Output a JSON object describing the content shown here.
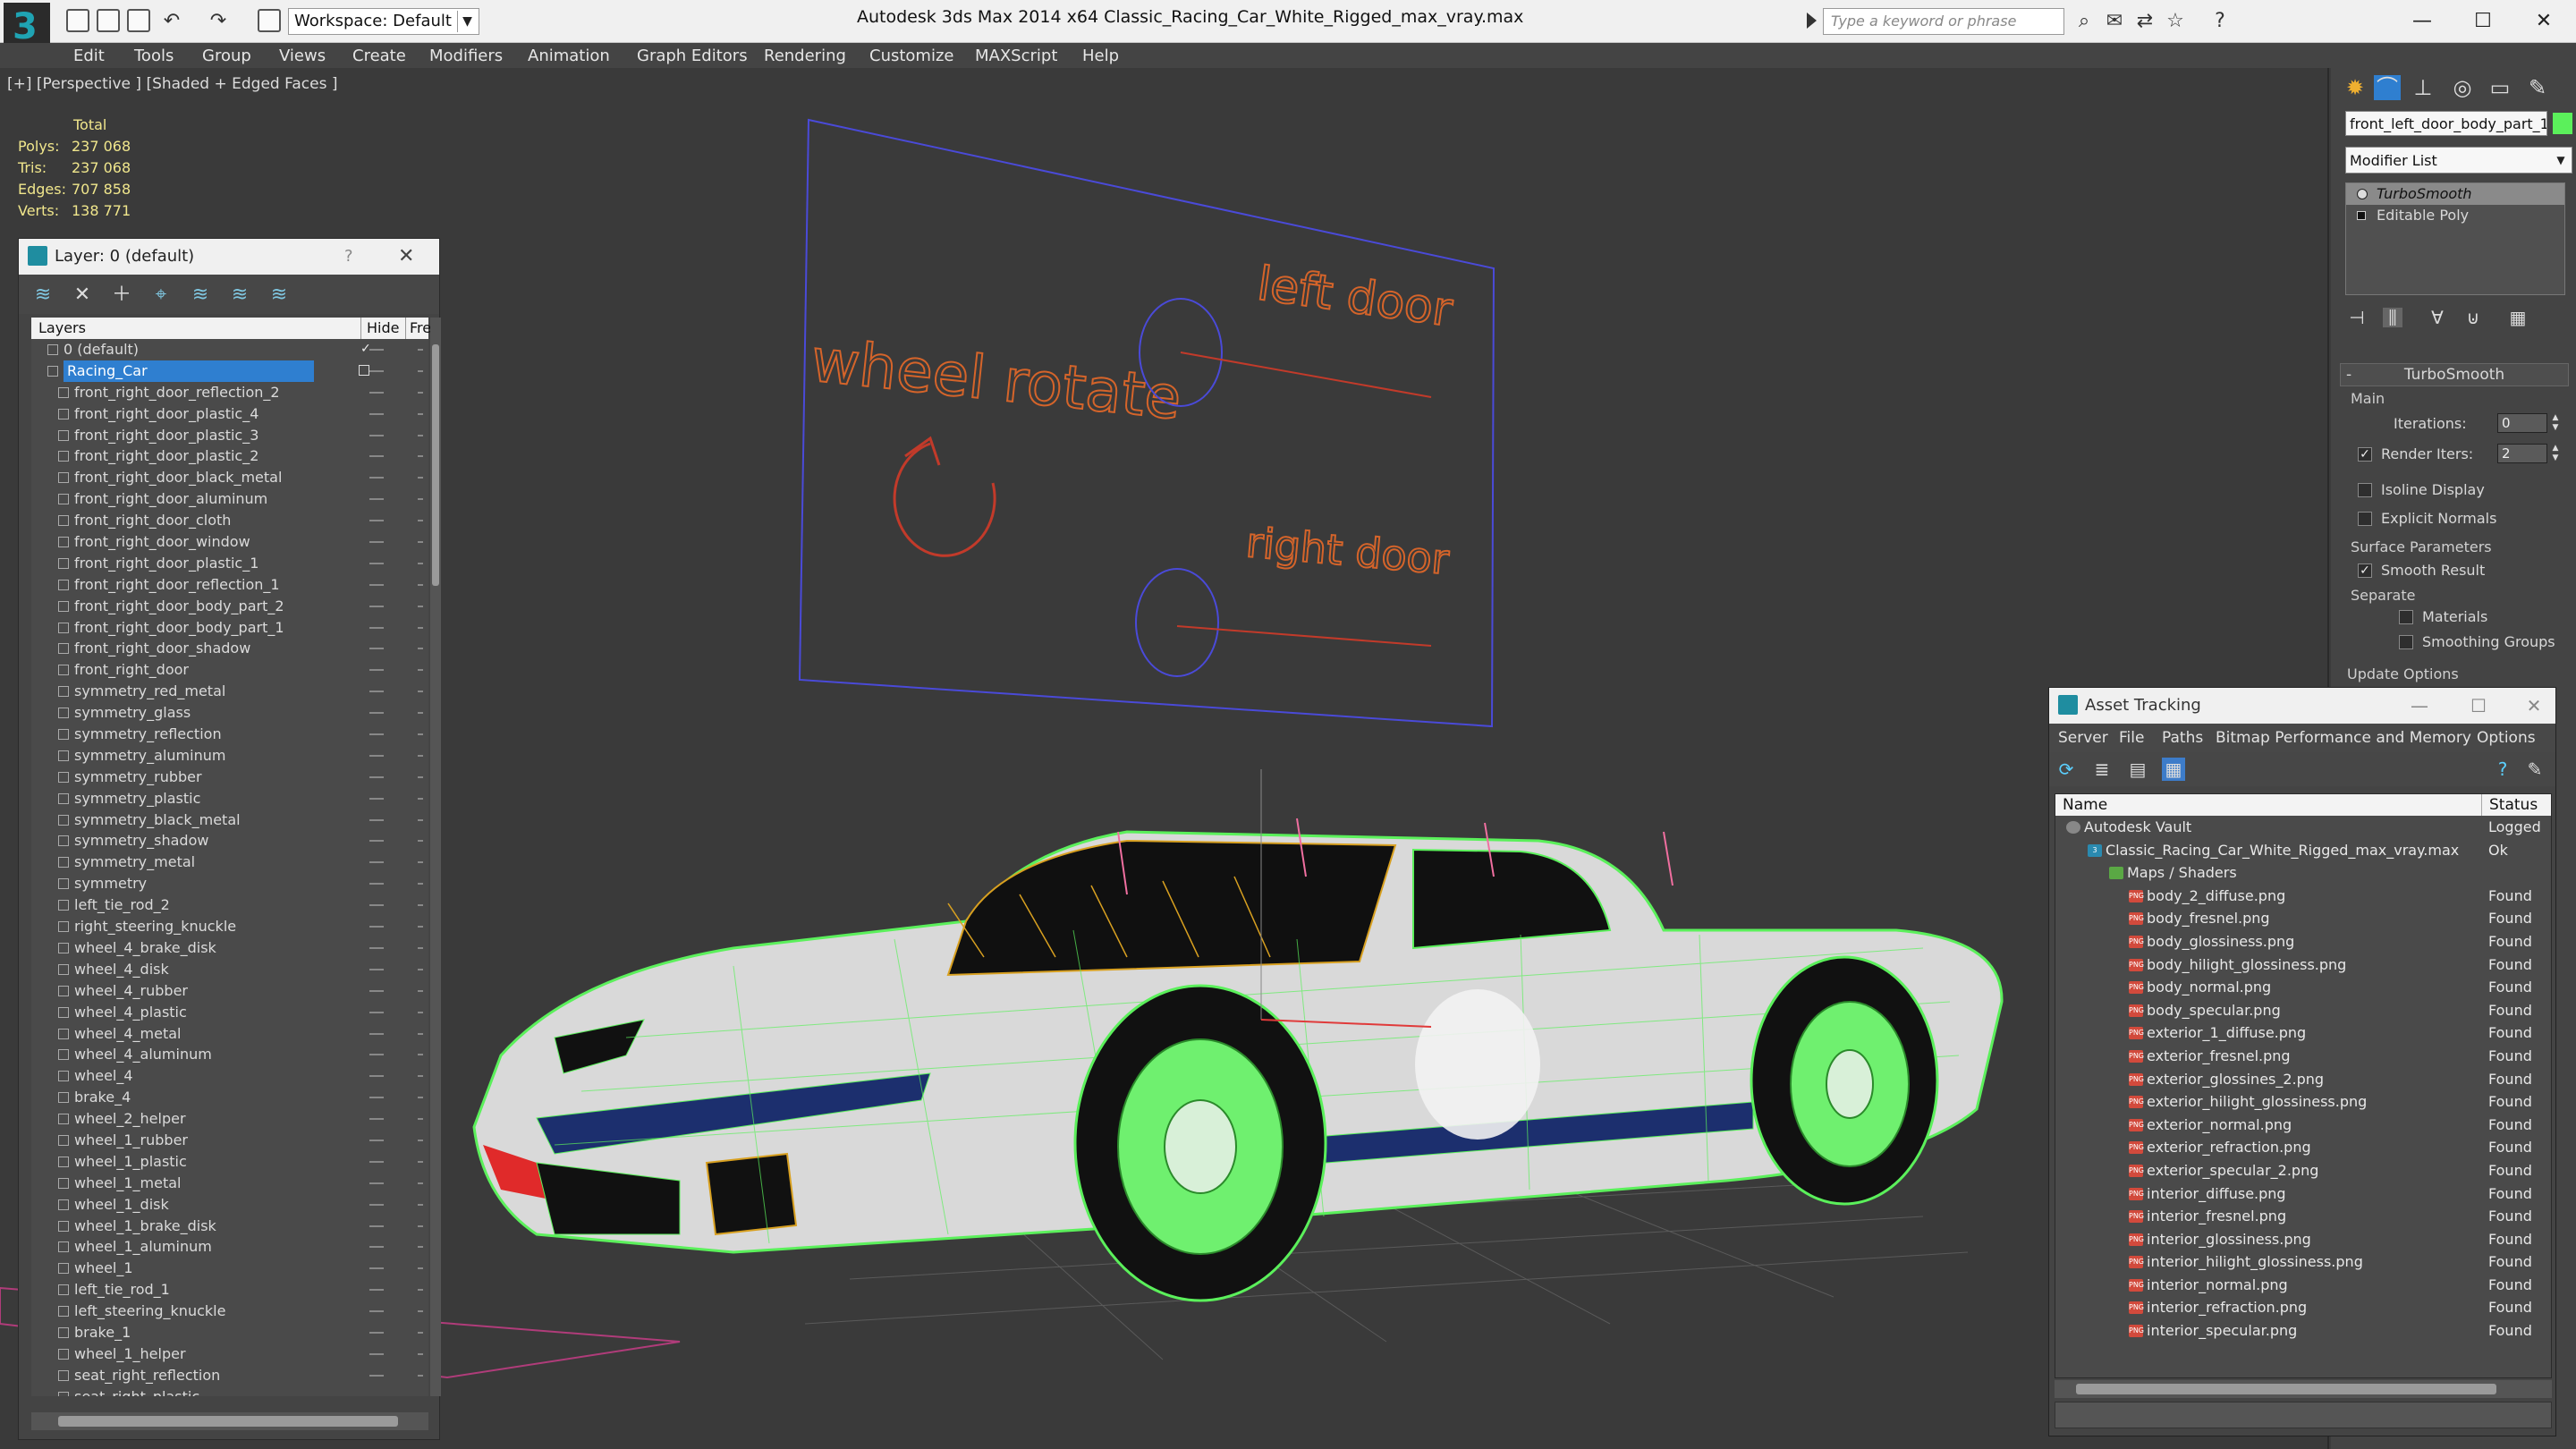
{
  "app": {
    "title": "Autodesk 3ds Max  2014 x64       Classic_Racing_Car_White_Rigged_max_vray.max",
    "workspace": "Workspace: Default",
    "search_placeholder": "Type a keyword or phrase"
  },
  "menu": [
    "Edit",
    "Tools",
    "Group",
    "Views",
    "Create",
    "Modifiers",
    "Animation",
    "Graph Editors",
    "Rendering",
    "Customize",
    "MAXScript",
    "Help"
  ],
  "viewport": {
    "label": "[+] [Perspective ] [Shaded + Edged Faces ]",
    "stats": {
      "header": "Total",
      "rows": [
        {
          "k": "Polys:",
          "v": "237 068"
        },
        {
          "k": "Tris:",
          "v": "237 068"
        },
        {
          "k": "Edges:",
          "v": "707 858"
        },
        {
          "k": "Verts:",
          "v": "138 771"
        }
      ]
    },
    "rig_panel": {
      "wheel_label": "wheel rotate",
      "left_door_label": "left door",
      "right_door_label": "right door"
    }
  },
  "layer_panel": {
    "title": "Layer: 0 (default)",
    "help": "?",
    "col_layers": "Layers",
    "col_hide": "Hide",
    "col_freeze": "Fre",
    "layers": [
      {
        "name": "0 (default)",
        "level": 0,
        "type": "layer",
        "checked": true
      },
      {
        "name": "Racing_Car",
        "level": 0,
        "type": "layer",
        "selected": true
      },
      {
        "name": "front_right_door_reflection_2",
        "level": 1
      },
      {
        "name": "front_right_door_plastic_4",
        "level": 1
      },
      {
        "name": "front_right_door_plastic_3",
        "level": 1
      },
      {
        "name": "front_right_door_plastic_2",
        "level": 1
      },
      {
        "name": "front_right_door_black_metal",
        "level": 1
      },
      {
        "name": "front_right_door_aluminum",
        "level": 1
      },
      {
        "name": "front_right_door_cloth",
        "level": 1
      },
      {
        "name": "front_right_door_window",
        "level": 1
      },
      {
        "name": "front_right_door_plastic_1",
        "level": 1
      },
      {
        "name": "front_right_door_reflection_1",
        "level": 1
      },
      {
        "name": "front_right_door_body_part_2",
        "level": 1
      },
      {
        "name": "front_right_door_body_part_1",
        "level": 1
      },
      {
        "name": "front_right_door_shadow",
        "level": 1
      },
      {
        "name": "front_right_door",
        "level": 1
      },
      {
        "name": "symmetry_red_metal",
        "level": 1
      },
      {
        "name": "symmetry_glass",
        "level": 1
      },
      {
        "name": "symmetry_reflection",
        "level": 1
      },
      {
        "name": "symmetry_aluminum",
        "level": 1
      },
      {
        "name": "symmetry_rubber",
        "level": 1
      },
      {
        "name": "symmetry_plastic",
        "level": 1
      },
      {
        "name": "symmetry_black_metal",
        "level": 1
      },
      {
        "name": "symmetry_shadow",
        "level": 1
      },
      {
        "name": "symmetry_metal",
        "level": 1
      },
      {
        "name": "symmetry",
        "level": 1
      },
      {
        "name": "left_tie_rod_2",
        "level": 1
      },
      {
        "name": "right_steering_knuckle",
        "level": 1
      },
      {
        "name": "wheel_4_brake_disk",
        "level": 1
      },
      {
        "name": "wheel_4_disk",
        "level": 1
      },
      {
        "name": "wheel_4_rubber",
        "level": 1
      },
      {
        "name": "wheel_4_plastic",
        "level": 1
      },
      {
        "name": "wheel_4_metal",
        "level": 1
      },
      {
        "name": "wheel_4_aluminum",
        "level": 1
      },
      {
        "name": "wheel_4",
        "level": 1
      },
      {
        "name": "brake_4",
        "level": 1
      },
      {
        "name": "wheel_2_helper",
        "level": 1
      },
      {
        "name": "wheel_1_rubber",
        "level": 1
      },
      {
        "name": "wheel_1_plastic",
        "level": 1
      },
      {
        "name": "wheel_1_metal",
        "level": 1
      },
      {
        "name": "wheel_1_disk",
        "level": 1
      },
      {
        "name": "wheel_1_brake_disk",
        "level": 1
      },
      {
        "name": "wheel_1_aluminum",
        "level": 1
      },
      {
        "name": "wheel_1",
        "level": 1
      },
      {
        "name": "left_tie_rod_1",
        "level": 1
      },
      {
        "name": "left_steering_knuckle",
        "level": 1
      },
      {
        "name": "brake_1",
        "level": 1
      },
      {
        "name": "wheel_1_helper",
        "level": 1
      },
      {
        "name": "seat_right_reflection",
        "level": 1
      },
      {
        "name": "seat_right_plastic",
        "level": 1
      }
    ]
  },
  "command_panel": {
    "object_name": "front_left_door_body_part_1",
    "modifier_list": "Modifier List",
    "stack": [
      {
        "name": "TurboSmooth",
        "selected": true
      },
      {
        "name": "Editable Poly",
        "selected": false
      }
    ],
    "rollout_title": "TurboSmooth",
    "main_group": "Main",
    "iterations_label": "Iterations:",
    "iterations_value": "0",
    "render_iters_label": "Render Iters:",
    "render_iters_value": "2",
    "isoline_label": "Isoline Display",
    "explicit_normals_label": "Explicit Normals",
    "surface_group": "Surface Parameters",
    "smooth_result_label": "Smooth Result",
    "separate_label": "Separate",
    "materials_label": "Materials",
    "smoothing_groups_label": "Smoothing Groups",
    "update_options": "Update Options"
  },
  "asset_tracking": {
    "title": "Asset Tracking",
    "menu": [
      "Server",
      "File",
      "Paths",
      "Bitmap Performance and Memory",
      "Options"
    ],
    "col_name": "Name",
    "col_status": "Status",
    "rows": [
      {
        "name": "Autodesk Vault",
        "status": "Logged",
        "level": 0,
        "icon": "vault"
      },
      {
        "name": "Classic_Racing_Car_White_Rigged_max_vray.max",
        "status": "Ok",
        "level": 1,
        "icon": "max"
      },
      {
        "name": "Maps / Shaders",
        "status": "",
        "level": 2,
        "icon": "folder"
      },
      {
        "name": "body_2_diffuse.png",
        "status": "Found",
        "level": 3,
        "icon": "png"
      },
      {
        "name": "body_fresnel.png",
        "status": "Found",
        "level": 3,
        "icon": "png"
      },
      {
        "name": "body_glossiness.png",
        "status": "Found",
        "level": 3,
        "icon": "png"
      },
      {
        "name": "body_hilight_glossiness.png",
        "status": "Found",
        "level": 3,
        "icon": "png"
      },
      {
        "name": "body_normal.png",
        "status": "Found",
        "level": 3,
        "icon": "png"
      },
      {
        "name": "body_specular.png",
        "status": "Found",
        "level": 3,
        "icon": "png"
      },
      {
        "name": "exterior_1_diffuse.png",
        "status": "Found",
        "level": 3,
        "icon": "png"
      },
      {
        "name": "exterior_fresnel.png",
        "status": "Found",
        "level": 3,
        "icon": "png"
      },
      {
        "name": "exterior_glossines_2.png",
        "status": "Found",
        "level": 3,
        "icon": "png"
      },
      {
        "name": "exterior_hilight_glossiness.png",
        "status": "Found",
        "level": 3,
        "icon": "png"
      },
      {
        "name": "exterior_normal.png",
        "status": "Found",
        "level": 3,
        "icon": "png"
      },
      {
        "name": "exterior_refraction.png",
        "status": "Found",
        "level": 3,
        "icon": "png"
      },
      {
        "name": "exterior_specular_2.png",
        "status": "Found",
        "level": 3,
        "icon": "png"
      },
      {
        "name": "interior_diffuse.png",
        "status": "Found",
        "level": 3,
        "icon": "png"
      },
      {
        "name": "interior_fresnel.png",
        "status": "Found",
        "level": 3,
        "icon": "png"
      },
      {
        "name": "interior_glossiness.png",
        "status": "Found",
        "level": 3,
        "icon": "png"
      },
      {
        "name": "interior_hilight_glossiness.png",
        "status": "Found",
        "level": 3,
        "icon": "png"
      },
      {
        "name": "interior_normal.png",
        "status": "Found",
        "level": 3,
        "icon": "png"
      },
      {
        "name": "interior_refraction.png",
        "status": "Found",
        "level": 3,
        "icon": "png"
      },
      {
        "name": "interior_specular.png",
        "status": "Found",
        "level": 3,
        "icon": "png"
      }
    ]
  },
  "colors": {
    "wire_green": "#5bf05b",
    "selection_blue": "#2f7fd0",
    "stats_yellow": "#f0e68c",
    "rig_orange": "#d5642a",
    "car_white": "#d9d9d9",
    "stripe_blue": "#1c2f6e"
  }
}
